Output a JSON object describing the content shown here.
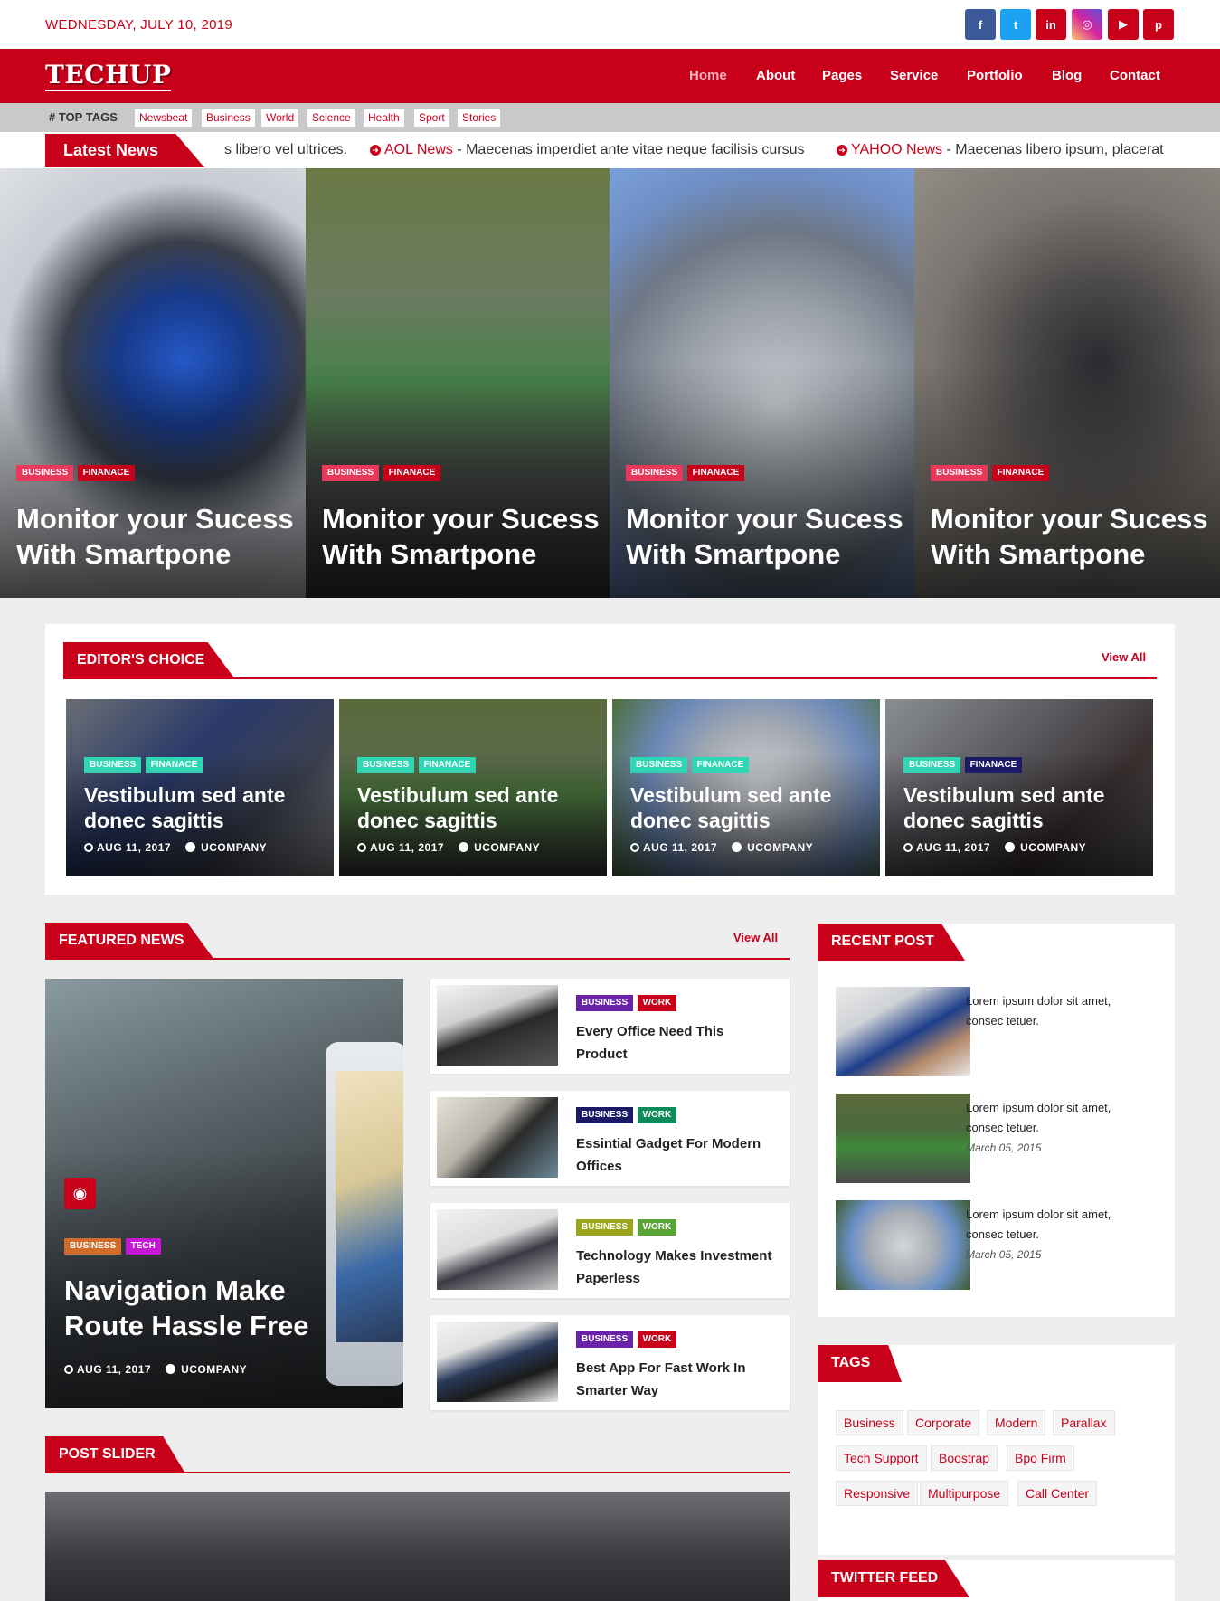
{
  "topbar": {
    "date": "WEDNESDAY, JULY 10, 2019",
    "social": [
      {
        "icon": "facebook-icon",
        "glyph": "f",
        "color": "#3b5998"
      },
      {
        "icon": "twitter-icon",
        "glyph": "t",
        "color": "#1da1f2"
      },
      {
        "icon": "linkedin-icon",
        "glyph": "in",
        "color": "#c8001a"
      },
      {
        "icon": "instagram-icon",
        "glyph": "◎",
        "color": "#d6249f"
      },
      {
        "icon": "youtube-icon",
        "glyph": "▶",
        "color": "#c8001a"
      },
      {
        "icon": "pinterest-icon",
        "glyph": "p",
        "color": "#c8001a"
      }
    ]
  },
  "header": {
    "logo": "TECHUP",
    "nav": [
      "Home",
      "About",
      "Pages",
      "Service",
      "Portfolio",
      "Blog",
      "Contact"
    ]
  },
  "top_tags": {
    "label": "TOP TAGS",
    "items": [
      "Newsbeat",
      "Business",
      "World",
      "Science",
      "Health",
      "Sport",
      "Stories"
    ]
  },
  "latest_news": {
    "label": "Latest News",
    "ticker": [
      {
        "source": "",
        "text": "s libero vel ultrices."
      },
      {
        "source": "AOL News",
        "text": " - Maecenas imperdiet ante vitae neque facilisis cursus"
      },
      {
        "source": "YAHOO News",
        "text": " - Maecenas libero ipsum, placerat"
      }
    ]
  },
  "hero": [
    {
      "badges": [
        "BUSINESS",
        "FINANACE"
      ],
      "title": "Monitor your Sucess With Smartpone"
    },
    {
      "badges": [
        "BUSINESS",
        "FINANACE"
      ],
      "title": "Monitor your Sucess With Smartpone"
    },
    {
      "badges": [
        "BUSINESS",
        "FINANACE"
      ],
      "title": "Monitor your Sucess With Smartpone"
    },
    {
      "badges": [
        "BUSINESS",
        "FINANACE"
      ],
      "title": "Monitor your Sucess With Smartpone"
    }
  ],
  "editors_choice": {
    "heading": "EDITOR'S CHOICE",
    "view_all": "View All",
    "cards": [
      {
        "badges": [
          "BUSINESS",
          "FINANACE"
        ],
        "title": "Vestibulum sed ante donec sagittis",
        "date": "AUG 11, 2017",
        "author": "UCOMPANY"
      },
      {
        "badges": [
          "BUSINESS",
          "FINANACE"
        ],
        "title": "Vestibulum sed ante donec sagittis",
        "date": "AUG 11, 2017",
        "author": "UCOMPANY"
      },
      {
        "badges": [
          "BUSINESS",
          "FINANACE"
        ],
        "title": "Vestibulum sed ante donec sagittis",
        "date": "AUG 11, 2017",
        "author": "UCOMPANY"
      },
      {
        "badges": [
          "BUSINESS",
          "FINANACE"
        ],
        "title": "Vestibulum sed ante donec sagittis",
        "date": "AUG 11, 2017",
        "author": "UCOMPANY"
      }
    ]
  },
  "featured_news": {
    "heading": "FEATURED NEWS",
    "view_all": "View All",
    "main": {
      "badges": [
        "BUSINESS",
        "TECH"
      ],
      "title": "Navigation Make Route Hassle Free",
      "date": "AUG 11, 2017",
      "author": "UCOMPANY"
    },
    "list": [
      {
        "badges": [
          "BUSINESS",
          "WORK"
        ],
        "title": "Every Office Need This Product"
      },
      {
        "badges": [
          "BUSINESS",
          "WORK"
        ],
        "title": "Essintial Gadget For Modern Offices"
      },
      {
        "badges": [
          "BUSINESS",
          "WORK"
        ],
        "title": "Technology Makes Investment Paperless"
      },
      {
        "badges": [
          "BUSINESS",
          "WORK"
        ],
        "title": "Best App For Fast Work In Smarter Way"
      }
    ]
  },
  "post_slider": {
    "heading": "POST SLIDER"
  },
  "recent_post": {
    "heading": "RECENT POST",
    "items": [
      {
        "text": "Lorem ipsum dolor sit amet, consec tetuer.",
        "date": ""
      },
      {
        "text": "Lorem ipsum dolor sit amet, consec tetuer.",
        "date": "March 05, 2015"
      },
      {
        "text": "Lorem ipsum dolor sit amet, consec tetuer.",
        "date": "March 05, 2015"
      }
    ]
  },
  "tags": {
    "heading": "TAGS",
    "items": [
      "Business",
      "Corporate",
      "Modern",
      "Parallax",
      "Tech Support",
      "Boostrap",
      "Bpo Firm",
      "Responsive",
      "Multipurpose",
      "Call Center"
    ]
  },
  "twitter_feed": {
    "heading": "TWITTER FEED"
  }
}
